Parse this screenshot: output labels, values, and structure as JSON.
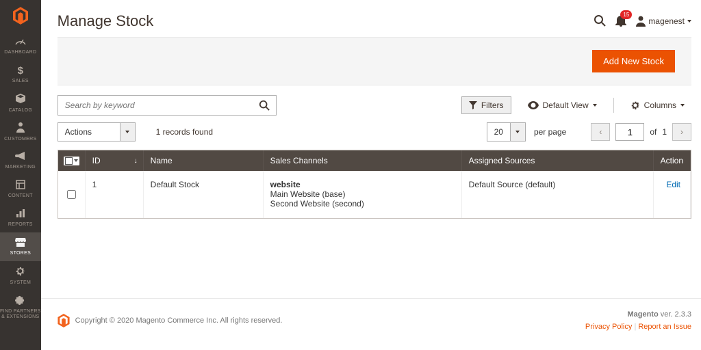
{
  "sidebar": {
    "items": [
      {
        "label": "DASHBOARD"
      },
      {
        "label": "SALES"
      },
      {
        "label": "CATALOG"
      },
      {
        "label": "CUSTOMERS"
      },
      {
        "label": "MARKETING"
      },
      {
        "label": "CONTENT"
      },
      {
        "label": "REPORTS"
      },
      {
        "label": "STORES"
      },
      {
        "label": "SYSTEM"
      },
      {
        "label": "FIND PARTNERS\n& EXTENSIONS"
      }
    ]
  },
  "header": {
    "title": "Manage Stock",
    "notification_count": "15",
    "username": "magenest"
  },
  "actions": {
    "add_button": "Add New Stock"
  },
  "search": {
    "placeholder": "Search by keyword"
  },
  "toolbar": {
    "filters": "Filters",
    "default_view": "Default View",
    "columns": "Columns"
  },
  "mass_actions": {
    "label": "Actions"
  },
  "records_found": "1 records found",
  "pager": {
    "per_page_value": "20",
    "per_page_label": "per page",
    "page": "1",
    "of_label": "of",
    "total": "1"
  },
  "grid": {
    "headers": {
      "id": "ID",
      "name": "Name",
      "sales_channels": "Sales Channels",
      "assigned_sources": "Assigned Sources",
      "action": "Action"
    },
    "rows": [
      {
        "id": "1",
        "name": "Default Stock",
        "sales_channels_title": "website",
        "sales_channels_line1": "Main Website (base)",
        "sales_channels_line2": "Second Website (second)",
        "assigned_sources": "Default Source (default)",
        "action": "Edit"
      }
    ]
  },
  "footer": {
    "copyright": "Copyright © 2020 Magento Commerce Inc. All rights reserved.",
    "product": "Magento",
    "ver_label": "ver.",
    "version": "2.3.3",
    "privacy": "Privacy Policy",
    "report": "Report an Issue"
  }
}
